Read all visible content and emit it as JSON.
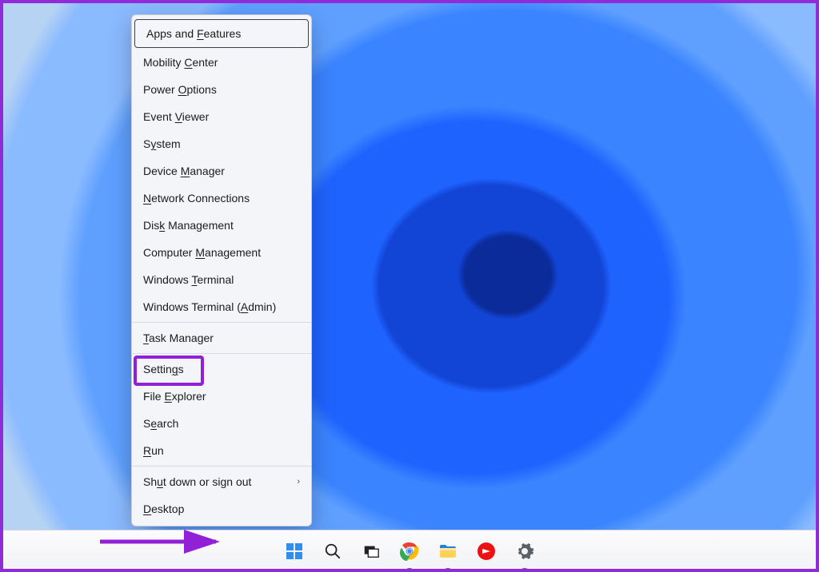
{
  "context_menu": {
    "items": [
      {
        "label": "Apps and Features",
        "u": [
          9
        ],
        "separator_after": false,
        "highlighted": true
      },
      {
        "label": "Mobility Center",
        "u": [
          9
        ]
      },
      {
        "label": "Power Options",
        "u": [
          6
        ]
      },
      {
        "label": "Event Viewer",
        "u": [
          6
        ]
      },
      {
        "label": "System",
        "u": [
          1
        ]
      },
      {
        "label": "Device Manager",
        "u": [
          7
        ]
      },
      {
        "label": "Network Connections",
        "u": [
          0
        ]
      },
      {
        "label": "Disk Management",
        "u": [
          3
        ]
      },
      {
        "label": "Computer Management",
        "u": [
          9
        ]
      },
      {
        "label": "Windows Terminal",
        "u": [
          8
        ]
      },
      {
        "label": "Windows Terminal (Admin)",
        "u": [
          18
        ],
        "separator_after": true
      },
      {
        "label": "Task Manager",
        "u": [
          0
        ],
        "separator_after": true
      },
      {
        "label": "Settings",
        "u": [
          6
        ],
        "annotated": true
      },
      {
        "label": "File Explorer",
        "u": [
          5
        ]
      },
      {
        "label": "Search",
        "u": [
          1
        ]
      },
      {
        "label": "Run",
        "u": [
          0
        ],
        "separator_after": true
      },
      {
        "label": "Shut down or sign out",
        "u": [
          2
        ],
        "submenu": true
      },
      {
        "label": "Desktop",
        "u": [
          0
        ]
      }
    ]
  },
  "taskbar": {
    "items": [
      {
        "name": "start",
        "active": false
      },
      {
        "name": "search",
        "active": false
      },
      {
        "name": "task-view",
        "active": false
      },
      {
        "name": "chrome",
        "active": true
      },
      {
        "name": "file-explorer",
        "active": true
      },
      {
        "name": "notepad",
        "active": false
      },
      {
        "name": "settings",
        "active": true
      }
    ]
  },
  "annotation": {
    "highlight_color": "#9120d6"
  }
}
